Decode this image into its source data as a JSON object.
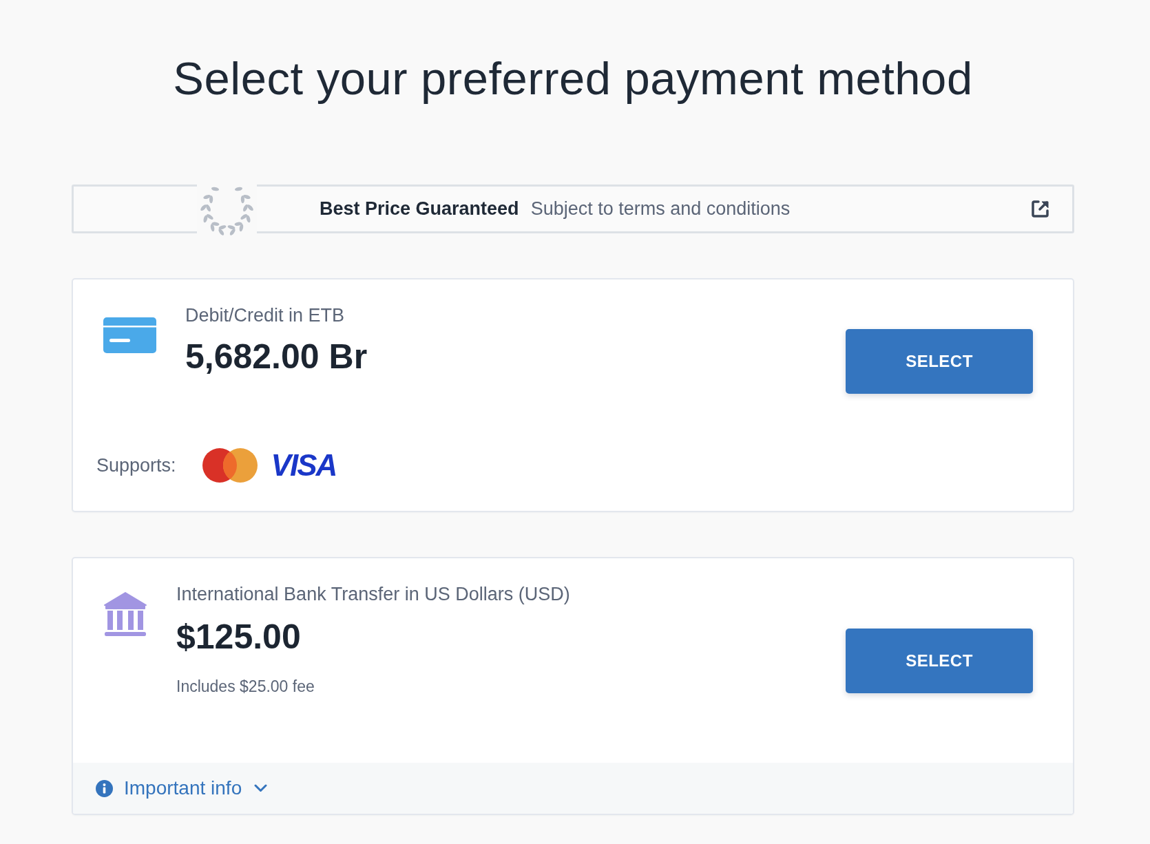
{
  "page": {
    "title": "Select your preferred payment method"
  },
  "banner": {
    "title": "Best Price Guaranteed",
    "subtitle": "Subject to terms and conditions"
  },
  "payment_methods": [
    {
      "kind": "card",
      "label": "Debit/Credit in ETB",
      "price": "5,682.00 Br",
      "button": "SELECT",
      "supports": {
        "label": "Supports:",
        "networks": [
          {
            "kind": "circles"
          },
          {
            "kind": "wordmark",
            "text": "VISA"
          }
        ]
      }
    },
    {
      "kind": "bank",
      "label": "International Bank Transfer in US Dollars (USD)",
      "price": "$125.00",
      "note": "Includes $25.00 fee",
      "button": "SELECT",
      "info": {
        "label": "Important info",
        "expanded": false
      }
    }
  ]
}
